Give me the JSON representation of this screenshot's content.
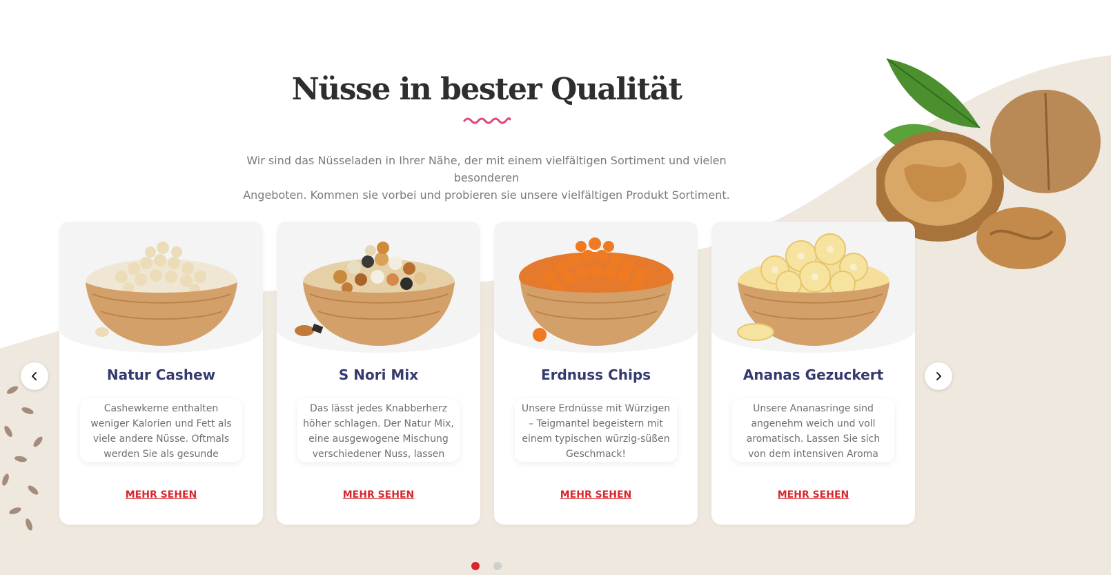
{
  "section": {
    "title": "Nüsse in bester Qualität",
    "intro_line1": "Wir sind das Nüsseladen in Ihrer Nähe, der mit einem vielfältigen Sortiment und vielen besonderen",
    "intro_line2": "Angeboten. Kommen sie vorbei und probieren sie unsere vielfältigen Produkt Sortiment."
  },
  "products": [
    {
      "name": "Natur Cashew",
      "description": "Cashewkerne enthalten weniger Kalorien und Fett als viele andere Nüsse. Oftmals werden Sie als gesunde Nervennahrung",
      "link": "MEHR SEHEN",
      "image": "cashew-bowl"
    },
    {
      "name": "S Nori Mix",
      "description": "Das lässt jedes Knabberherz höher schlagen. Der Natur Mix, eine ausgewogene Mischung verschiedener Nuss, lassen keine",
      "link": "MEHR SEHEN",
      "image": "nori-mix-bowl"
    },
    {
      "name": "Erdnuss Chips",
      "description": "Unsere Erdnüsse mit Würzigen – Teigmantel begeistern mit einem typischen würzig-süßen Geschmack!",
      "link": "MEHR SEHEN",
      "image": "peanut-chips-bowl"
    },
    {
      "name": "Ananas Gezuckert",
      "description": "Unsere Ananasringe sind angenehm weich und voll aromatisch. Lassen Sie sich von dem intensiven Aroma",
      "link": "MEHR SEHEN",
      "image": "pineapple-bowl"
    }
  ],
  "carousel": {
    "prev_icon": "chevron-left-icon",
    "next_icon": "chevron-right-icon",
    "page_count": 2,
    "active_page": 1
  },
  "colors": {
    "title": "#2e2e2e",
    "squiggle": "#e8437a",
    "card_title": "#343a6e",
    "link": "#d8262e",
    "dot_active": "#d8262e",
    "dot_inactive": "#cfcfcf",
    "background_wave": "#efe8df"
  }
}
